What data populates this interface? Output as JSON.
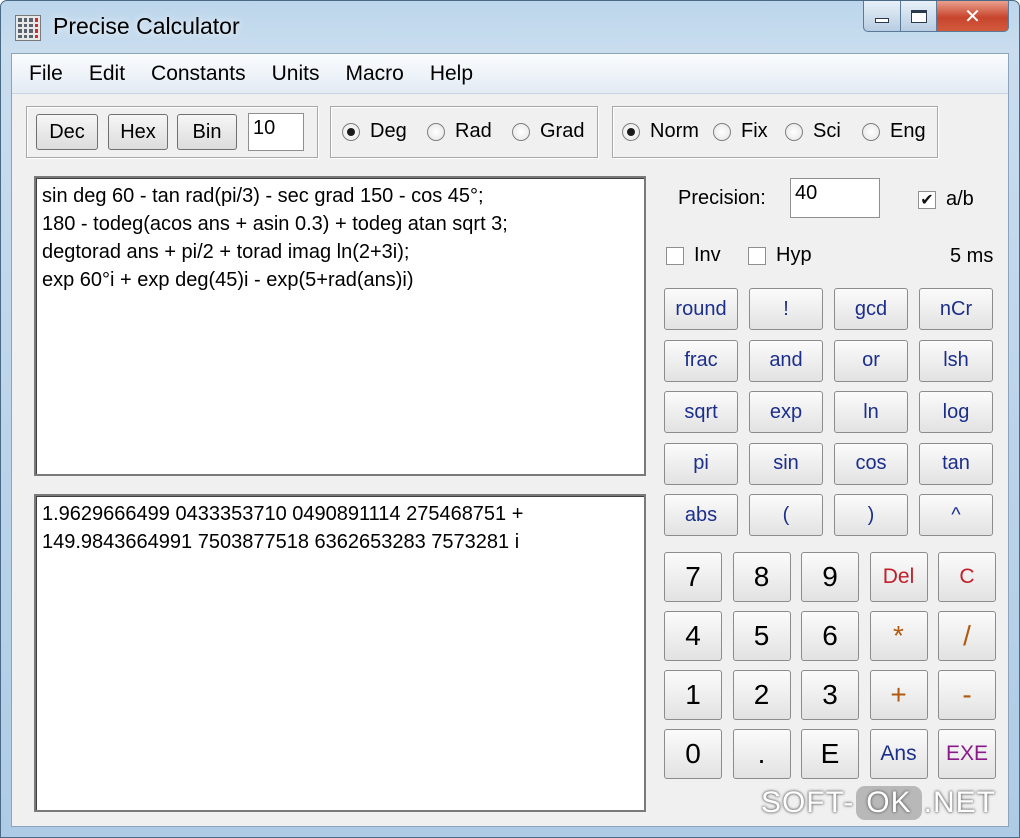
{
  "window": {
    "title": "Precise Calculator"
  },
  "menu": [
    "File",
    "Edit",
    "Constants",
    "Units",
    "Macro",
    "Help"
  ],
  "base": {
    "buttons": [
      "Dec",
      "Hex",
      "Bin"
    ],
    "value": "10"
  },
  "angle": {
    "options": [
      "Deg",
      "Rad",
      "Grad"
    ],
    "selected": "Deg"
  },
  "notation": {
    "options": [
      "Norm",
      "Fix",
      "Sci",
      "Eng"
    ],
    "selected": "Norm"
  },
  "precision": {
    "label": "Precision:",
    "value": "40",
    "fraction_label": "a/b",
    "fraction_checked": true
  },
  "modifiers": {
    "inv_label": "Inv",
    "inv_checked": false,
    "hyp_label": "Hyp",
    "hyp_checked": false,
    "timing": "5 ms"
  },
  "expression": [
    "sin deg 60 - tan rad(pi/3) - sec grad 150 - cos 45°;",
    "180 - todeg(acos ans + asin 0.3) + todeg atan sqrt 3;",
    "degtorad ans + pi/2 + torad imag ln(2+3i);",
    "exp 60°i + exp deg(45)i - exp(5+rad(ans)i)"
  ],
  "result": [
    "1.9629666499 0433353710 0490891114 275468751 +",
    "149.9843664991 7503877518 6362653283 7573281 i"
  ],
  "function_keys": [
    [
      "round",
      "!",
      "gcd",
      "nCr"
    ],
    [
      "frac",
      "and",
      "or",
      "lsh"
    ],
    [
      "sqrt",
      "exp",
      "ln",
      "log"
    ],
    [
      "pi",
      "sin",
      "cos",
      "tan"
    ],
    [
      "abs",
      "(",
      ")",
      "^"
    ]
  ],
  "number_keys": [
    [
      "7",
      "8",
      "9",
      "Del",
      "C"
    ],
    [
      "4",
      "5",
      "6",
      "*",
      "/"
    ],
    [
      "1",
      "2",
      "3",
      "+",
      "-"
    ],
    [
      "0",
      ".",
      "E",
      "Ans",
      "EXE"
    ]
  ],
  "icons": {
    "app": "calculator-grid-icon",
    "minimize": "minimize-icon",
    "maximize": "maximize-icon",
    "close": "close-icon",
    "checkmark": "checkmark-icon"
  },
  "colors": {
    "function_text": "#1c2e8c",
    "delete_clear_text": "#c0202a",
    "operator_text": "#b05a10",
    "ans_text": "#1c2e8c",
    "exe_text": "#8a1a8a"
  },
  "watermark": {
    "left": "SOFT-",
    "badge": "OK",
    "right": ".NET"
  }
}
